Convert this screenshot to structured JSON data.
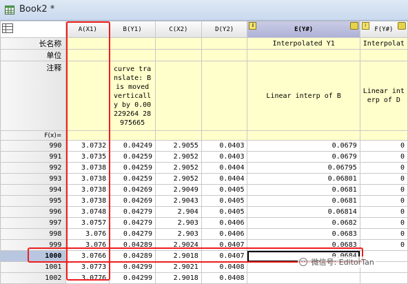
{
  "window": {
    "title": "Book2 *"
  },
  "columns": [
    {
      "label": "A(X1)"
    },
    {
      "label": "B(Y1)"
    },
    {
      "label": "C(X2)"
    },
    {
      "label": "D(Y2)"
    },
    {
      "label": "E(Y#)"
    },
    {
      "label": "F(Y#)"
    }
  ],
  "row_labels": {
    "long_name": "长名称",
    "units": "单位",
    "comments": "注释",
    "fx": "F(x)="
  },
  "long_names": [
    "",
    "",
    "",
    "",
    "Interpolated Y1",
    "Interpolat"
  ],
  "comments": [
    "",
    "curve translate: B is moved vertically by 0.00229264 28975665",
    "",
    "",
    "Linear interp of B",
    "Linear interp of D"
  ],
  "rows": [
    {
      "n": "990",
      "cells": [
        "3.0732",
        "0.04249",
        "2.9055",
        "0.0403",
        "0.0679",
        "0"
      ]
    },
    {
      "n": "991",
      "cells": [
        "3.0735",
        "0.04259",
        "2.9052",
        "0.0403",
        "0.0679",
        "0"
      ]
    },
    {
      "n": "992",
      "cells": [
        "3.0738",
        "0.04259",
        "2.9052",
        "0.0404",
        "0.06795",
        "0"
      ]
    },
    {
      "n": "993",
      "cells": [
        "3.0738",
        "0.04259",
        "2.9052",
        "0.0404",
        "0.06801",
        "0"
      ]
    },
    {
      "n": "994",
      "cells": [
        "3.0738",
        "0.04269",
        "2.9049",
        "0.0405",
        "0.0681",
        "0"
      ]
    },
    {
      "n": "995",
      "cells": [
        "3.0738",
        "0.04269",
        "2.9043",
        "0.0405",
        "0.0681",
        "0"
      ]
    },
    {
      "n": "996",
      "cells": [
        "3.0748",
        "0.04279",
        "2.904",
        "0.0405",
        "0.06814",
        "0"
      ]
    },
    {
      "n": "997",
      "cells": [
        "3.0757",
        "0.04279",
        "2.903",
        "0.0406",
        "0.0682",
        "0"
      ]
    },
    {
      "n": "998",
      "cells": [
        "3.076",
        "0.04279",
        "2.903",
        "0.0406",
        "0.0683",
        "0"
      ]
    },
    {
      "n": "999",
      "cells": [
        "3.076",
        "0.04289",
        "2.9024",
        "0.0407",
        "0.0683",
        "0"
      ]
    },
    {
      "n": "1000",
      "cells": [
        "3.0766",
        "0.04289",
        "2.9018",
        "0.0407",
        "0.0684",
        ""
      ]
    },
    {
      "n": "1001",
      "cells": [
        "3.0773",
        "0.04299",
        "2.9021",
        "0.0408",
        "",
        ""
      ]
    },
    {
      "n": "1002",
      "cells": [
        "3.0776",
        "0.04299",
        "2.9018",
        "0.0408",
        "",
        ""
      ]
    }
  ],
  "watermark": "微信号: EditorTan",
  "colors": {
    "highlight_box": "#ee1c1c",
    "selected_header": "#aeb1d6",
    "meta_fill": "#ffffcc"
  }
}
